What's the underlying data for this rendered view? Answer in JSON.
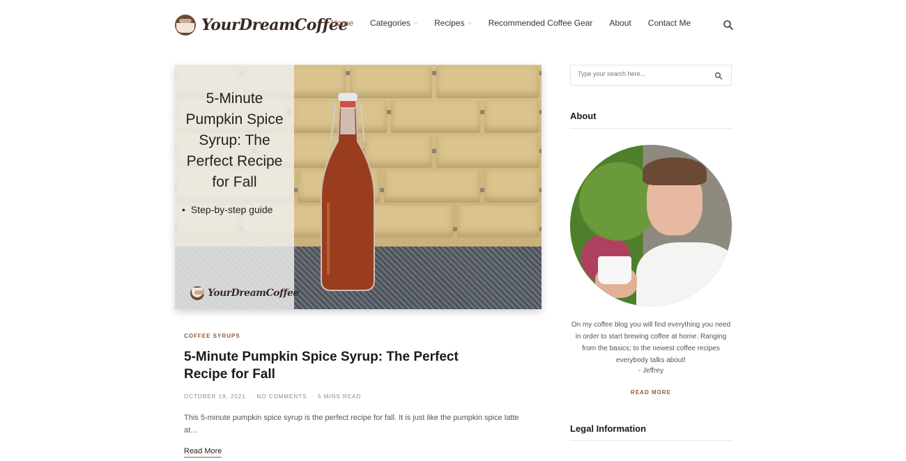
{
  "brand": {
    "name": "YourDreamCoffee"
  },
  "nav": {
    "items": [
      {
        "label": "Home",
        "active": true,
        "dropdown": false
      },
      {
        "label": "Categories",
        "active": false,
        "dropdown": true
      },
      {
        "label": "Recipes",
        "active": false,
        "dropdown": true
      },
      {
        "label": "Recommended Coffee Gear",
        "active": false,
        "dropdown": false
      },
      {
        "label": "About",
        "active": false,
        "dropdown": false
      },
      {
        "label": "Contact Me",
        "active": false,
        "dropdown": false
      }
    ],
    "search_icon": "search-icon"
  },
  "featured_image": {
    "overlay_title": "5-Minute Pumpkin Spice Syrup: The Perfect Recipe for Fall",
    "overlay_bullet": "Step-by-step guide",
    "watermark": "YourDreamCoffee"
  },
  "post": {
    "category": "COFFEE SYRUPS",
    "title": "5-Minute Pumpkin Spice Syrup: The Perfect Recipe for Fall",
    "date": "OCTOBER 19, 2021",
    "comments": "NO COMMENTS",
    "read_time": "5 MINS READ",
    "excerpt": "This 5-minute pumpkin spice syrup is the perfect recipe for fall. It is just like the pumpkin spice latte at…",
    "read_more": "Read More"
  },
  "sidebar": {
    "search_placeholder": "Type your search here...",
    "about": {
      "title": "About",
      "text": "On my coffee blog you will find everything you need in order to start brewing coffee at home. Ranging from the basics; to the newest coffee recipes everybody talks about!",
      "signature": "- Jeffrey",
      "read_more": "READ MORE"
    },
    "legal": {
      "title": "Legal Information"
    }
  },
  "colors": {
    "accent": "#8a5a3c",
    "text": "#222222",
    "muted": "#888888"
  }
}
